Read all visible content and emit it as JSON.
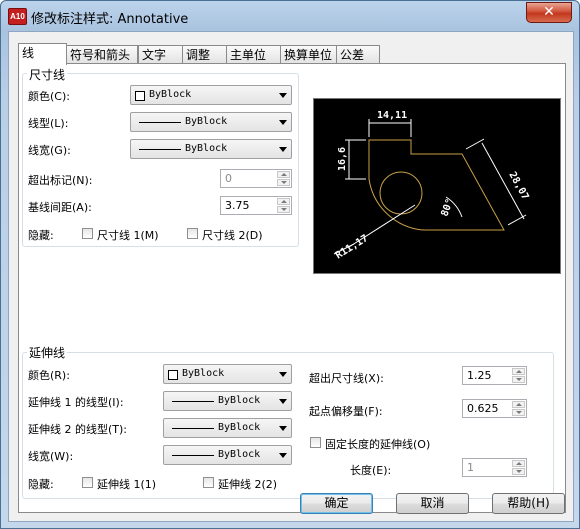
{
  "window": {
    "title": "修改标注样式: Annotative",
    "app_icon_text": "A10",
    "close_glyph": "✕"
  },
  "tabs": [
    {
      "label": "线",
      "active": true
    },
    {
      "label": "符号和箭头"
    },
    {
      "label": "文字"
    },
    {
      "label": "调整"
    },
    {
      "label": "主单位"
    },
    {
      "label": "换算单位"
    },
    {
      "label": "公差"
    }
  ],
  "dim_lines": {
    "group_label": "尺寸线",
    "color": {
      "label": "颜色(C):",
      "value": "ByBlock"
    },
    "linetype": {
      "label": "线型(L):",
      "value": "ByBlock"
    },
    "lineweight": {
      "label": "线宽(G):",
      "value": "ByBlock"
    },
    "extend_ticks": {
      "label": "超出标记(N):",
      "value": "0"
    },
    "baseline_spacing": {
      "label": "基线间距(A):",
      "value": "3.75"
    },
    "suppress": {
      "label": "隐藏:",
      "line1": "尺寸线 1(M)",
      "line2": "尺寸线 2(D)"
    }
  },
  "ext_lines": {
    "group_label": "延伸线",
    "color": {
      "label": "颜色(R):",
      "value": "ByBlock"
    },
    "linetype1": {
      "label": "延伸线 1 的线型(I):",
      "value": "ByBlock"
    },
    "linetype2": {
      "label": "延伸线 2 的线型(T):",
      "value": "ByBlock"
    },
    "lineweight": {
      "label": "线宽(W):",
      "value": "ByBlock"
    },
    "suppress": {
      "label": "隐藏:",
      "line1": "延伸线 1(1)",
      "line2": "延伸线 2(2)"
    },
    "extend_beyond": {
      "label": "超出尺寸线(X):",
      "value": "1.25"
    },
    "offset": {
      "label": "起点偏移量(F):",
      "value": "0.625"
    },
    "fixed_length": {
      "label": "固定长度的延伸线(O)"
    },
    "length": {
      "label": "长度(E):",
      "value": "1"
    }
  },
  "preview": {
    "dim_top": "14,11",
    "dim_left": "16,6",
    "dim_right": "28,07",
    "dim_angle": "80°",
    "dim_radius": "R11,17"
  },
  "buttons": {
    "ok": "确定",
    "cancel": "取消",
    "help": "帮助(H)"
  },
  "colors": {
    "preview_bg": "#000000",
    "geometry": "#c8a046",
    "dims": "#ffffff"
  }
}
